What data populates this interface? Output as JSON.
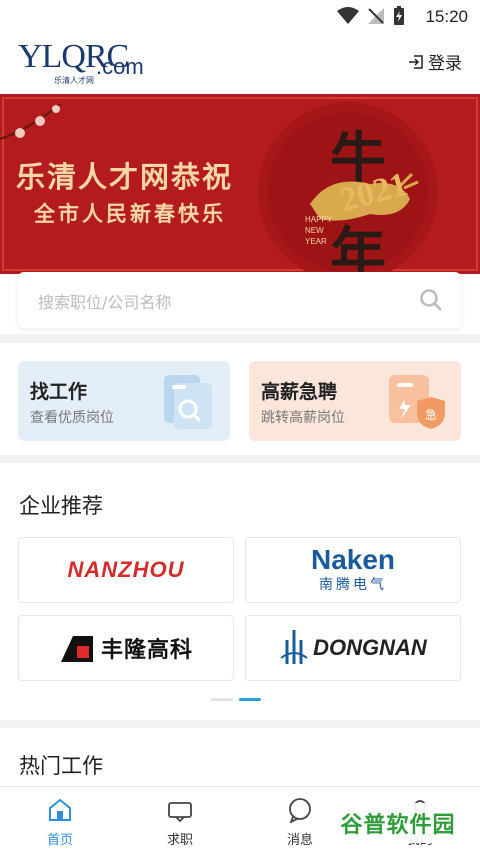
{
  "status_bar": {
    "time": "15:20"
  },
  "header": {
    "logo_main": "YLQRC",
    "logo_domain": ".com",
    "logo_sub": "乐清人才网",
    "login_label": "登录"
  },
  "banner": {
    "title": "乐清人才网恭祝",
    "subtitle": "全市人民新春快乐",
    "year": "2021",
    "char_top": "牛",
    "char_bottom": "年",
    "greeting_lines": [
      "HAPPY",
      "NEW",
      "YEAR"
    ]
  },
  "search": {
    "placeholder": "搜索职位/公司名称"
  },
  "quick_cards": [
    {
      "title": "找工作",
      "subtitle": "查看优质岗位",
      "color": "#e4eef8"
    },
    {
      "title": "高薪急聘",
      "subtitle": "跳转高薪岗位",
      "color": "#fbe6dc"
    }
  ],
  "enterprise": {
    "title": "企业推荐",
    "companies": [
      {
        "name": "NANZHOU"
      },
      {
        "name": "Naken",
        "cn": "南腾电气"
      },
      {
        "name": "丰隆高科"
      },
      {
        "name": "DONGNAN"
      }
    ]
  },
  "hot_jobs": {
    "title": "热门工作"
  },
  "tabs": [
    {
      "label": "首页",
      "icon": "home-icon",
      "active": true
    },
    {
      "label": "求职",
      "icon": "briefcase-icon",
      "active": false
    },
    {
      "label": "消息",
      "icon": "message-icon",
      "active": false
    },
    {
      "label": "我的",
      "icon": "user-icon",
      "active": false
    }
  ],
  "watermark": "谷普软件园",
  "colors": {
    "accent": "#2e8fe0",
    "banner_red": "#b31b1e",
    "gold": "#f5d6a5"
  }
}
